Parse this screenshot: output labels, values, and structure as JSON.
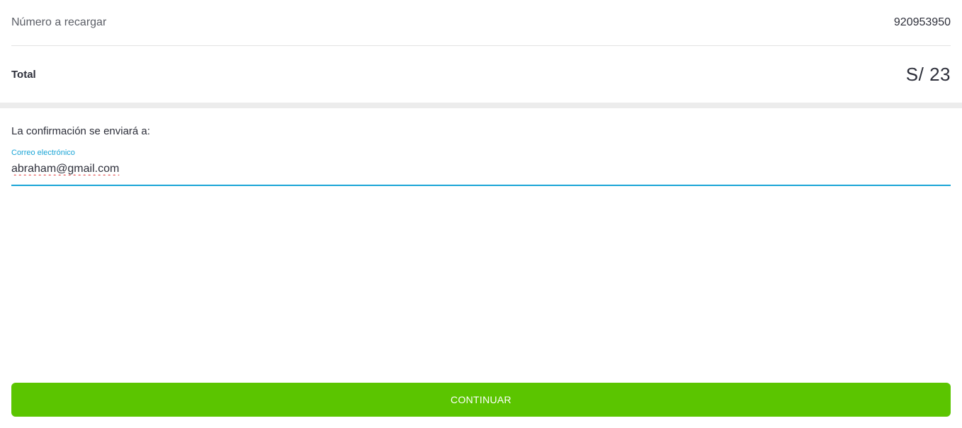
{
  "summary": {
    "number_label": "Número a recargar",
    "number_value": "920953950",
    "total_label": "Total",
    "total_value": "S/ 23"
  },
  "confirmation": {
    "label": "La confirmación se enviará a:",
    "email_field": {
      "label": "Correo electrónico",
      "value": "abraham@gmail.com"
    }
  },
  "actions": {
    "continue_label": "CONTINUAR"
  },
  "colors": {
    "accent_blue": "#19a4d6",
    "button_green": "#5bc500",
    "spellcheck_red": "#e03030"
  }
}
